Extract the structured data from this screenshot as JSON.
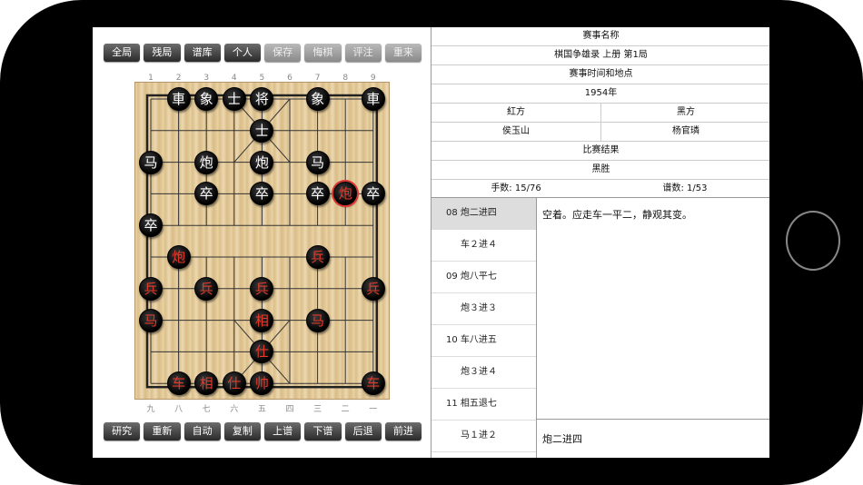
{
  "toolbar_top": [
    "全局",
    "残局",
    "谱库",
    "个人",
    "保存",
    "悔棋",
    "评注",
    "重来"
  ],
  "toolbar_top_dim": [
    false,
    false,
    false,
    false,
    true,
    true,
    true,
    true
  ],
  "toolbar_bottom": [
    "研究",
    "重新",
    "自动",
    "复制",
    "上谱",
    "下谱",
    "后退",
    "前进"
  ],
  "top_col_labels": [
    "1",
    "2",
    "3",
    "4",
    "5",
    "6",
    "7",
    "8",
    "9"
  ],
  "bottom_col_labels": [
    "九",
    "八",
    "七",
    "六",
    "五",
    "四",
    "三",
    "二",
    "一"
  ],
  "pieces": [
    {
      "c": "車",
      "col": 1,
      "row": 0,
      "side": "black"
    },
    {
      "c": "象",
      "col": 2,
      "row": 0,
      "side": "black"
    },
    {
      "c": "士",
      "col": 3,
      "row": 0,
      "side": "black"
    },
    {
      "c": "将",
      "col": 4,
      "row": 0,
      "side": "black"
    },
    {
      "c": "象",
      "col": 6,
      "row": 0,
      "side": "black"
    },
    {
      "c": "車",
      "col": 8,
      "row": 0,
      "side": "black"
    },
    {
      "c": "士",
      "col": 4,
      "row": 1,
      "side": "black"
    },
    {
      "c": "马",
      "col": 0,
      "row": 2,
      "side": "black"
    },
    {
      "c": "炮",
      "col": 2,
      "row": 2,
      "side": "black"
    },
    {
      "c": "炮",
      "col": 4,
      "row": 2,
      "side": "black"
    },
    {
      "c": "马",
      "col": 6,
      "row": 2,
      "side": "black"
    },
    {
      "c": "卒",
      "col": 2,
      "row": 3,
      "side": "black"
    },
    {
      "c": "卒",
      "col": 4,
      "row": 3,
      "side": "black"
    },
    {
      "c": "卒",
      "col": 6,
      "row": 3,
      "side": "black"
    },
    {
      "c": "炮",
      "col": 7,
      "row": 3,
      "side": "red",
      "selected": true
    },
    {
      "c": "卒",
      "col": 8,
      "row": 3,
      "side": "black"
    },
    {
      "c": "卒",
      "col": 0,
      "row": 4,
      "side": "black"
    },
    {
      "c": "炮",
      "col": 1,
      "row": 5,
      "side": "red"
    },
    {
      "c": "兵",
      "col": 6,
      "row": 5,
      "side": "red"
    },
    {
      "c": "兵",
      "col": 0,
      "row": 6,
      "side": "red"
    },
    {
      "c": "兵",
      "col": 2,
      "row": 6,
      "side": "red"
    },
    {
      "c": "兵",
      "col": 4,
      "row": 6,
      "side": "red"
    },
    {
      "c": "兵",
      "col": 8,
      "row": 6,
      "side": "red"
    },
    {
      "c": "马",
      "col": 0,
      "row": 7,
      "side": "red"
    },
    {
      "c": "相",
      "col": 4,
      "row": 7,
      "side": "red"
    },
    {
      "c": "马",
      "col": 6,
      "row": 7,
      "side": "red"
    },
    {
      "c": "仕",
      "col": 4,
      "row": 8,
      "side": "red"
    },
    {
      "c": "车",
      "col": 1,
      "row": 9,
      "side": "red"
    },
    {
      "c": "相",
      "col": 2,
      "row": 9,
      "side": "red"
    },
    {
      "c": "仕",
      "col": 3,
      "row": 9,
      "side": "red"
    },
    {
      "c": "帅",
      "col": 4,
      "row": 9,
      "side": "red"
    },
    {
      "c": "车",
      "col": 8,
      "row": 9,
      "side": "red"
    }
  ],
  "info": {
    "event_label": "赛事名称",
    "event_value": "棋国争雄录 上册 第1局",
    "time_place_label": "赛事时间和地点",
    "time_place_value": "1954年",
    "red_label": "紅方",
    "black_label": "黑方",
    "red_player": "侯玉山",
    "black_player": "杨官璘",
    "result_label": "比赛结果",
    "result_value": "黑胜",
    "moves_count": "手数: 15/76",
    "record_count": "谱数: 1/53"
  },
  "moves": [
    {
      "text": "08  炮二进四",
      "indent": false,
      "active": true
    },
    {
      "text": "车２进４",
      "indent": true,
      "active": false
    },
    {
      "text": "09  炮八平七",
      "indent": false,
      "active": false
    },
    {
      "text": "炮３进３",
      "indent": true,
      "active": false
    },
    {
      "text": "10  车八进五",
      "indent": false,
      "active": false
    },
    {
      "text": "炮３进４",
      "indent": true,
      "active": false
    },
    {
      "text": "11  相五退七",
      "indent": false,
      "active": false
    },
    {
      "text": "马１进２",
      "indent": true,
      "active": false
    }
  ],
  "comment": "空着。应走车一平二，静观其变。",
  "current_move": "炮二进四"
}
